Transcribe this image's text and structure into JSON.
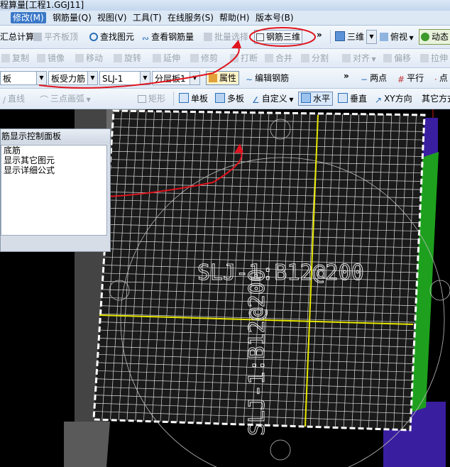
{
  "window": {
    "title": "程算量[工程1.GGJ11]"
  },
  "menubar": {
    "items": [
      "修改(M)",
      "钢筋量(Q)",
      "视图(V)",
      "工具(T)",
      "在线服务(S)",
      "帮助(H)",
      "版本号(B)"
    ],
    "active_index": 0
  },
  "toolbar1": {
    "summary_calc": "汇总计算",
    "align_slab_top": "平齐板顶",
    "find_element": "查找图元",
    "view_rebar_qty": "查看钢筋量",
    "batch_select": "批量选择",
    "rebar_3d": "钢筋三维",
    "more": "»",
    "view_3d": "三维",
    "top_view": "俯视",
    "dynamic_observe": "动态"
  },
  "toolbar2": {
    "items": [
      "复制",
      "镜像",
      "移动",
      "旋转",
      "延伸",
      "修剪",
      "打断",
      "合并",
      "分割",
      "对齐",
      "偏移",
      "拉伸"
    ]
  },
  "toolbar3": {
    "floor_select": "板",
    "type_select": "板受力筋",
    "name_select": "SLJ-1",
    "layer_select": "分层板1",
    "properties": "属性",
    "edit_rebar": "编辑钢筋",
    "more": "»",
    "two_points": "两点",
    "parallel": "平行",
    "point": "点"
  },
  "toolbar4": {
    "line": "直线",
    "three_point_arc": "三点画弧",
    "rectangle": "矩形",
    "single_slab": "单板",
    "multi_slab": "多板",
    "custom": "自定义",
    "horizontal": "水平",
    "vertical": "垂直",
    "xy_direction": "XY方向",
    "other_methods": "其它方式"
  },
  "panel": {
    "title": "筋显示控制面板",
    "items": [
      "底筋",
      "显示其它图元",
      "显示详细公式"
    ]
  },
  "canvas_labels": {
    "horizontal_rebar": "SLJ-1:B12@200",
    "vertical_rebar": "SLJ-1:B12@200"
  },
  "colors": {
    "annotation": "#e0141e",
    "grid": "#d8d8d8",
    "axis": "#e8e800",
    "beam_green": "#1ea01e",
    "beam_purple": "#3a1ea0",
    "gray_wall": "#6e6e6e"
  }
}
